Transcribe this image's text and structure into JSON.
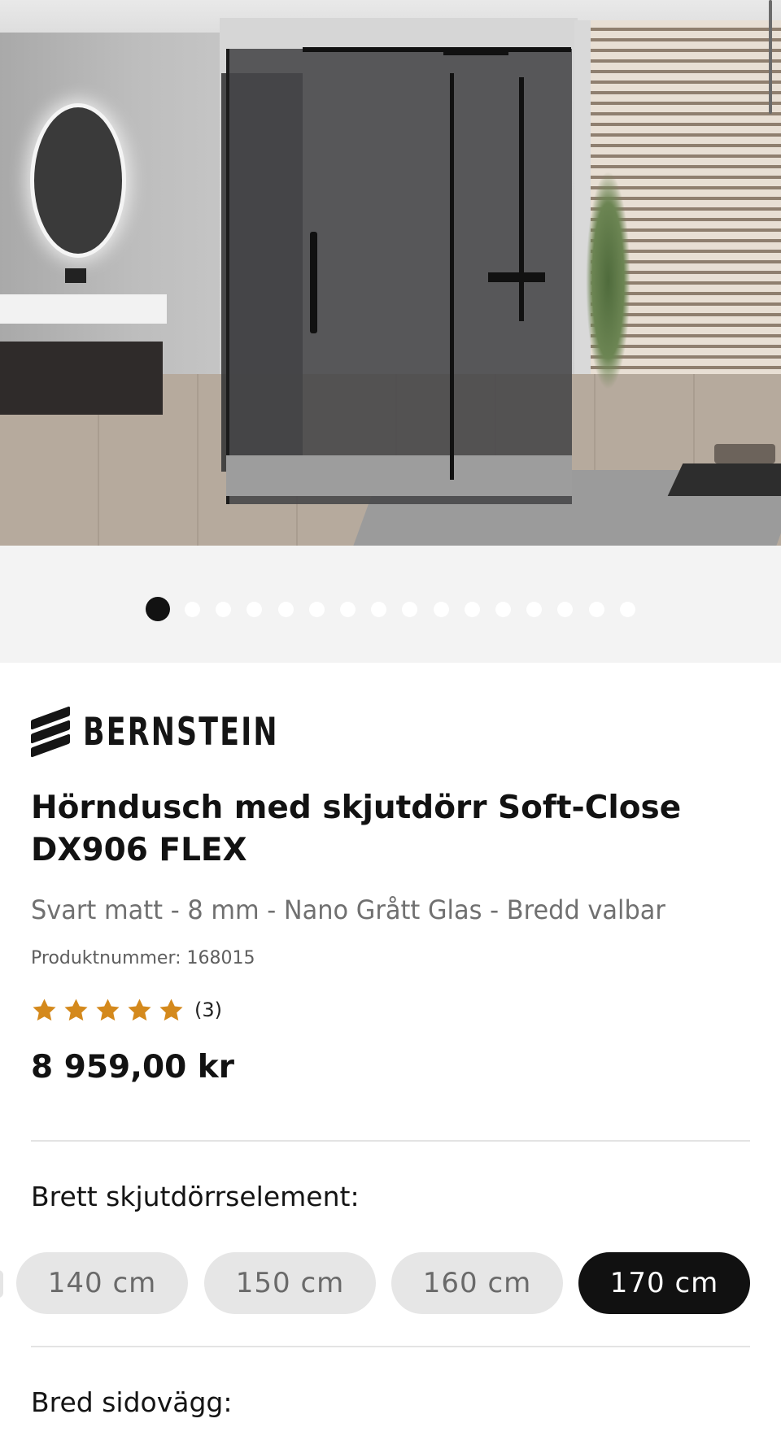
{
  "carousel": {
    "dot_count": 16,
    "active_index": 0
  },
  "brand": {
    "name": "BERNSTEIN"
  },
  "product": {
    "title_line1": "Hörndusch med skjutdörr Soft-Close",
    "title_line2": "DX906 FLEX",
    "subtitle": "Svart matt - 8 mm - Nano Grått Glas - Bredd valbar",
    "sku_text": "Produktnummer: 168015",
    "rating": {
      "stars": 5,
      "max": 5,
      "count_text": "(3)",
      "star_color": "#D4891C"
    },
    "price": "8 959,00 kr"
  },
  "options": {
    "door_width": {
      "label": "Brett skjutdörrselement:",
      "choices": [
        {
          "label": "140 cm",
          "selected": false
        },
        {
          "label": "150 cm",
          "selected": false
        },
        {
          "label": "160 cm",
          "selected": false
        },
        {
          "label": "170 cm",
          "selected": true
        }
      ]
    },
    "side_wall": {
      "label": "Bred sidovägg:"
    }
  }
}
